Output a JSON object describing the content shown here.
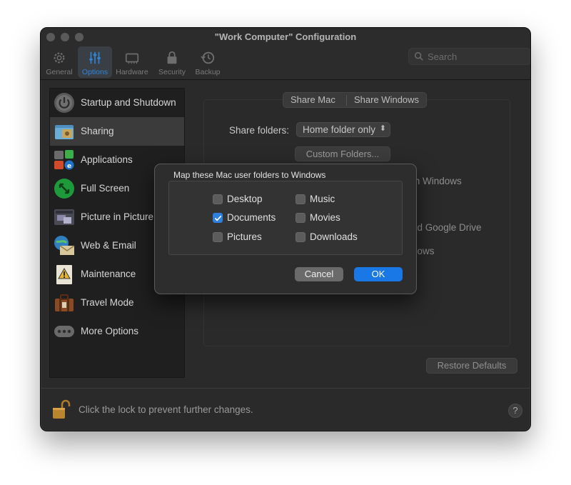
{
  "window": {
    "title": "\"Work Computer\" Configuration"
  },
  "toolbar": {
    "tabs": [
      {
        "label": "General",
        "icon": "gear-icon"
      },
      {
        "label": "Options",
        "icon": "sliders-icon",
        "active": true
      },
      {
        "label": "Hardware",
        "icon": "chip-icon"
      },
      {
        "label": "Security",
        "icon": "lock-icon"
      },
      {
        "label": "Backup",
        "icon": "clock-icon"
      }
    ],
    "search_placeholder": "Search"
  },
  "sidebar": {
    "items": [
      {
        "label": "Startup and Shutdown",
        "icon": "power-icon"
      },
      {
        "label": "Sharing",
        "icon": "shared-folder-icon",
        "selected": true
      },
      {
        "label": "Applications",
        "icon": "applications-icon"
      },
      {
        "label": "Full Screen",
        "icon": "full-screen-icon"
      },
      {
        "label": "Picture in Picture",
        "icon": "picture-in-picture-icon"
      },
      {
        "label": "Web & Email",
        "icon": "web-email-icon"
      },
      {
        "label": "Maintenance",
        "icon": "maintenance-icon"
      },
      {
        "label": "Travel Mode",
        "icon": "suitcase-icon"
      },
      {
        "label": "More Options",
        "icon": "more-options-icon"
      }
    ]
  },
  "main": {
    "segments": [
      "Share Mac",
      "Share Windows"
    ],
    "share_folders_label": "Share folders:",
    "share_folders_value": "Home folder only",
    "custom_folders_button": "Custom Folders...",
    "behind_text_1": "th Windows",
    "behind_text_2": "nd Google Drive",
    "behind_text_3": "dows",
    "restore_defaults": "Restore Defaults"
  },
  "footer": {
    "lock_text": "Click the lock to prevent further changes.",
    "help": "?"
  },
  "dialog": {
    "title": "Map these Mac user folders to Windows",
    "options": [
      {
        "label": "Desktop",
        "checked": false
      },
      {
        "label": "Documents",
        "checked": true
      },
      {
        "label": "Pictures",
        "checked": false
      },
      {
        "label": "Music",
        "checked": false
      },
      {
        "label": "Movies",
        "checked": false
      },
      {
        "label": "Downloads",
        "checked": false
      }
    ],
    "cancel": "Cancel",
    "ok": "OK"
  },
  "colors": {
    "accent": "#1a78e6",
    "window_bg": "#2a2a2a",
    "sidebar_bg": "#1f1f1f",
    "selected_row": "#3b3b3b"
  }
}
